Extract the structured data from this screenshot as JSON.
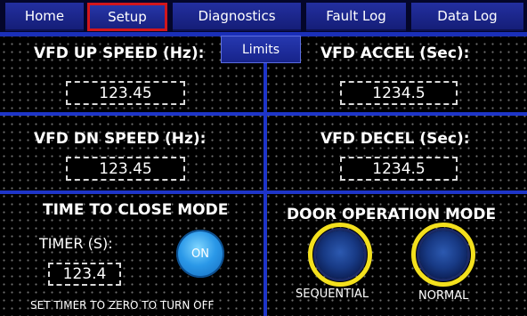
{
  "tabs": [
    {
      "label": "Home"
    },
    {
      "label": "Setup",
      "active": true
    },
    {
      "label": "Diagnostics"
    },
    {
      "label": "Fault Log"
    },
    {
      "label": "Data Log"
    }
  ],
  "sub_tab": {
    "label": "Limits"
  },
  "speed_panels": {
    "up_speed": {
      "label": "VFD UP SPEED (Hz):",
      "value": "123.45"
    },
    "accel": {
      "label": "VFD ACCEL (Sec):",
      "value": "1234.5"
    },
    "dn_speed": {
      "label": "VFD DN SPEED (Hz):",
      "value": "123.45"
    },
    "decel": {
      "label": "VFD DECEL (Sec):",
      "value": "1234.5"
    }
  },
  "time_to_close": {
    "title": "TIME TO CLOSE MODE",
    "timer_label": "TIMER (S):",
    "timer_value": "123.4",
    "toggle_label": "ON",
    "hint": "SET TIMER TO ZERO TO TURN OFF"
  },
  "door_mode": {
    "title": "DOOR OPERATION MODE",
    "options": [
      {
        "label": "SEQUENTIAL"
      },
      {
        "label": "NORMAL"
      }
    ]
  },
  "colors": {
    "divider": "#1e35c8",
    "active_tab_border": "#d2161c",
    "lamp_ring": "#f3e01d",
    "toggle_on": "#2a98e8"
  }
}
